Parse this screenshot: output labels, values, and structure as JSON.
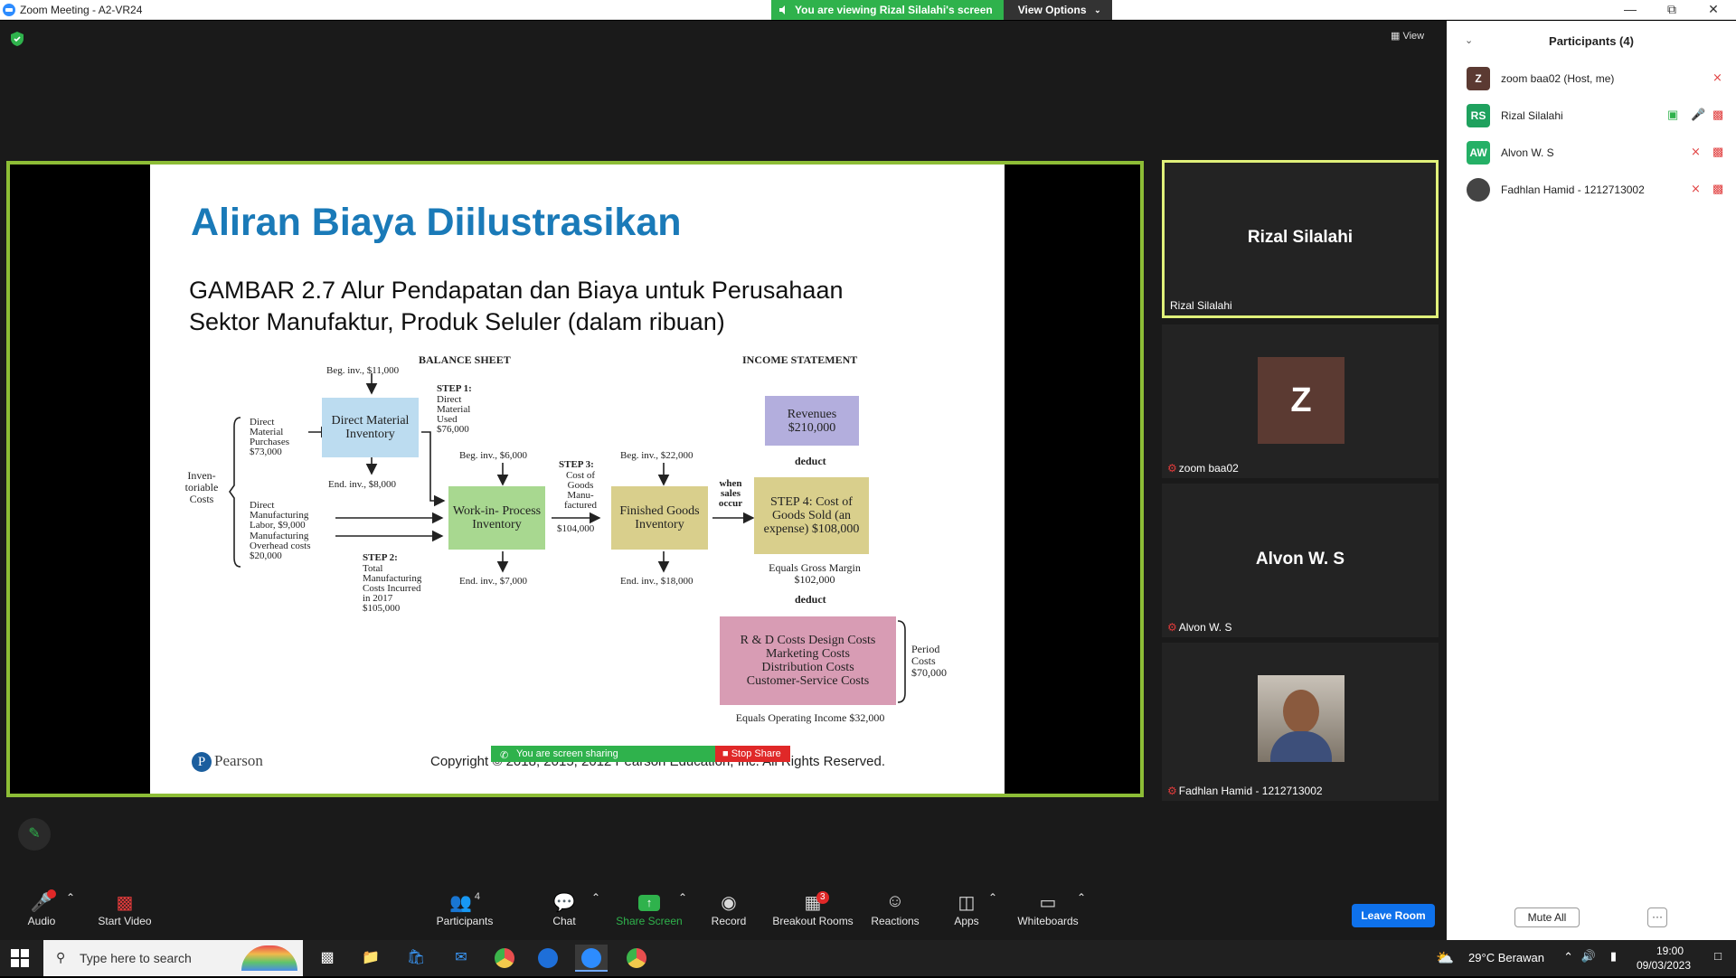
{
  "window": {
    "title": "Zoom Meeting - A2-VR24"
  },
  "banner": {
    "viewing_text": "You are viewing Rizal Silalahi's screen",
    "view_options": "View Options"
  },
  "view_button": "View",
  "slide": {
    "title": "Aliran Biaya Diilustrasikan",
    "subtitle_line1": "GAMBAR 2.7 Alur Pendapatan  dan Biaya untuk Perusahaan",
    "subtitle_line2": "Sektor Manufaktur, Produk Seluler (dalam ribuan)",
    "copyright": "Copyright © 2018, 2015, 2012 Pearson Education, Inc. All Rights Reserved.",
    "pearson": "Pearson",
    "diagram": {
      "balance_sheet": "BALANCE SHEET",
      "income_statement": "INCOME STATEMENT",
      "beg_inv_11000": "Beg. inv., $11,000",
      "direct_material_inventory": "Direct Material Inventory",
      "end_inv_8000": "End. inv., $8,000",
      "step1": "STEP 1:",
      "step1_text": "Direct Material Used $76,000",
      "dm_purchases": "Direct Material Purchases $73,000",
      "inventoriable": "Inven- toriable Costs",
      "dm_labor": "Direct Manufacturing Labor, $9,000",
      "mfg_overhead": "Manufacturing Overhead costs $20,000",
      "step2": "STEP 2:",
      "step2_text": "Total Manufacturing Costs Incurred in 2017 $105,000",
      "beg_inv_6000": "Beg. inv., $6,000",
      "wip": "Work-in- Process Inventory",
      "end_inv_7000": "End. inv., $7,000",
      "step3": "STEP 3:",
      "step3_text": "Cost of Goods Manu- factured",
      "cogm_value": "$104,000",
      "beg_inv_22000": "Beg. inv., $22,000",
      "fg": "Finished Goods Inventory",
      "end_inv_18000": "End. inv., $18,000",
      "when_sales": "when sales occur",
      "revenues": "Revenues $210,000",
      "deduct1": "deduct",
      "step4": "STEP 4: Cost of Goods Sold (an expense) $108,000",
      "gross_margin": "Equals Gross Margin $102,000",
      "deduct2": "deduct",
      "period_costs_box": "R & D Costs Design Costs Marketing Costs Distribution Costs Customer-Service Costs",
      "period_costs": "Period Costs $70,000",
      "operating_income": "Equals Operating Income $32,000"
    }
  },
  "share_control": {
    "sharing_text": "You are screen sharing",
    "stop_share": "Stop Share"
  },
  "tiles": [
    {
      "name": "Rizal Silalahi",
      "label": "Rizal Silalahi"
    },
    {
      "avatar_letter": "Z",
      "label": "zoom baa02"
    },
    {
      "name": "Alvon W. S",
      "label": "Alvon W. S"
    },
    {
      "label": "Fadhlan Hamid - 1212713002"
    }
  ],
  "toolbar": {
    "audio": "Audio",
    "start_video": "Start Video",
    "participants": "Participants",
    "participants_count": "4",
    "chat": "Chat",
    "share_screen": "Share Screen",
    "record": "Record",
    "breakout_rooms": "Breakout Rooms",
    "breakout_badge": "3",
    "reactions": "Reactions",
    "apps": "Apps",
    "whiteboards": "Whiteboards",
    "leave_room": "Leave Room"
  },
  "participants_panel": {
    "title": "Participants (4)",
    "items": [
      {
        "initials": "Z",
        "name": "zoom baa02 (Host, me)",
        "color": "#5b3a32"
      },
      {
        "initials": "RS",
        "name": "Rizal Silalahi",
        "color": "#1fa15e"
      },
      {
        "initials": "AW",
        "name": "Alvon W. S",
        "color": "#25b066"
      },
      {
        "initials": "",
        "name": "Fadhlan Hamid - 1212713002",
        "color": "#444444"
      }
    ],
    "mute_all": "Mute All",
    "more": "···"
  },
  "taskbar": {
    "search_placeholder": "Type here to search",
    "weather": "29°C  Berawan",
    "time": "19:00",
    "date": "09/03/2023"
  }
}
